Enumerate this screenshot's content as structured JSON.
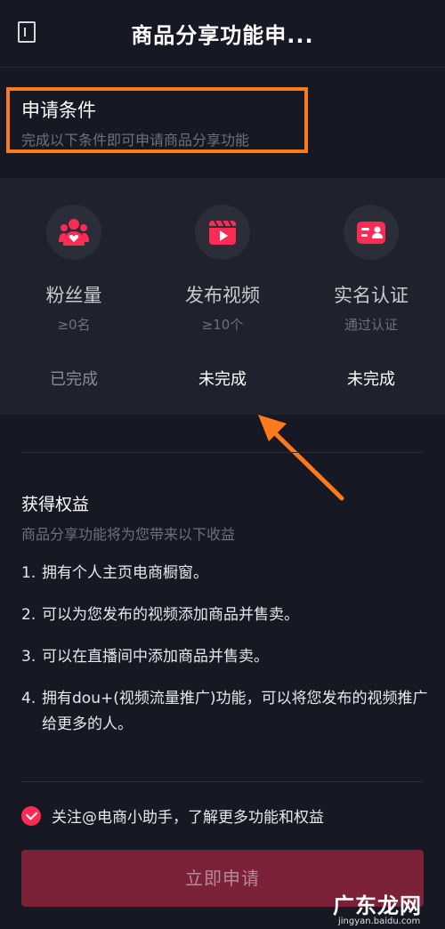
{
  "header": {
    "title": "商品分享功能申..."
  },
  "conditions": {
    "title": "申请条件",
    "subtitle": "完成以下条件即可申请商品分享功能",
    "items": [
      {
        "name": "粉丝量",
        "requirement": "≥0名",
        "status": "已完成",
        "icon": "fans-icon"
      },
      {
        "name": "发布视频",
        "requirement": "≥10个",
        "status": "未完成",
        "icon": "video-icon"
      },
      {
        "name": "实名认证",
        "requirement": "通过认证",
        "status": "未完成",
        "icon": "id-card-icon"
      }
    ]
  },
  "benefits": {
    "title": "获得权益",
    "subtitle": "商品分享功能将为您带来以下收益",
    "items": [
      {
        "num": "1.",
        "text": "拥有个人主页电商橱窗。"
      },
      {
        "num": "2.",
        "text": "可以为您发布的视频添加商品并售卖。"
      },
      {
        "num": "3.",
        "text": "可以在直播间中添加商品并售卖。"
      },
      {
        "num": "4.",
        "text": "拥有dou+(视频流量推广)功能，可以将您发布的视频推广给更多的人。"
      }
    ]
  },
  "agreement": {
    "text": "关注@电商小助手，了解更多功能和权益",
    "checked": true
  },
  "apply_button": {
    "label": "立即申请"
  },
  "watermark": {
    "text": "广东龙网",
    "url": "jingyan.baidu.com"
  },
  "colors": {
    "accent": "#fe2c55",
    "highlight": "#ff7a1a",
    "background": "#161823"
  }
}
